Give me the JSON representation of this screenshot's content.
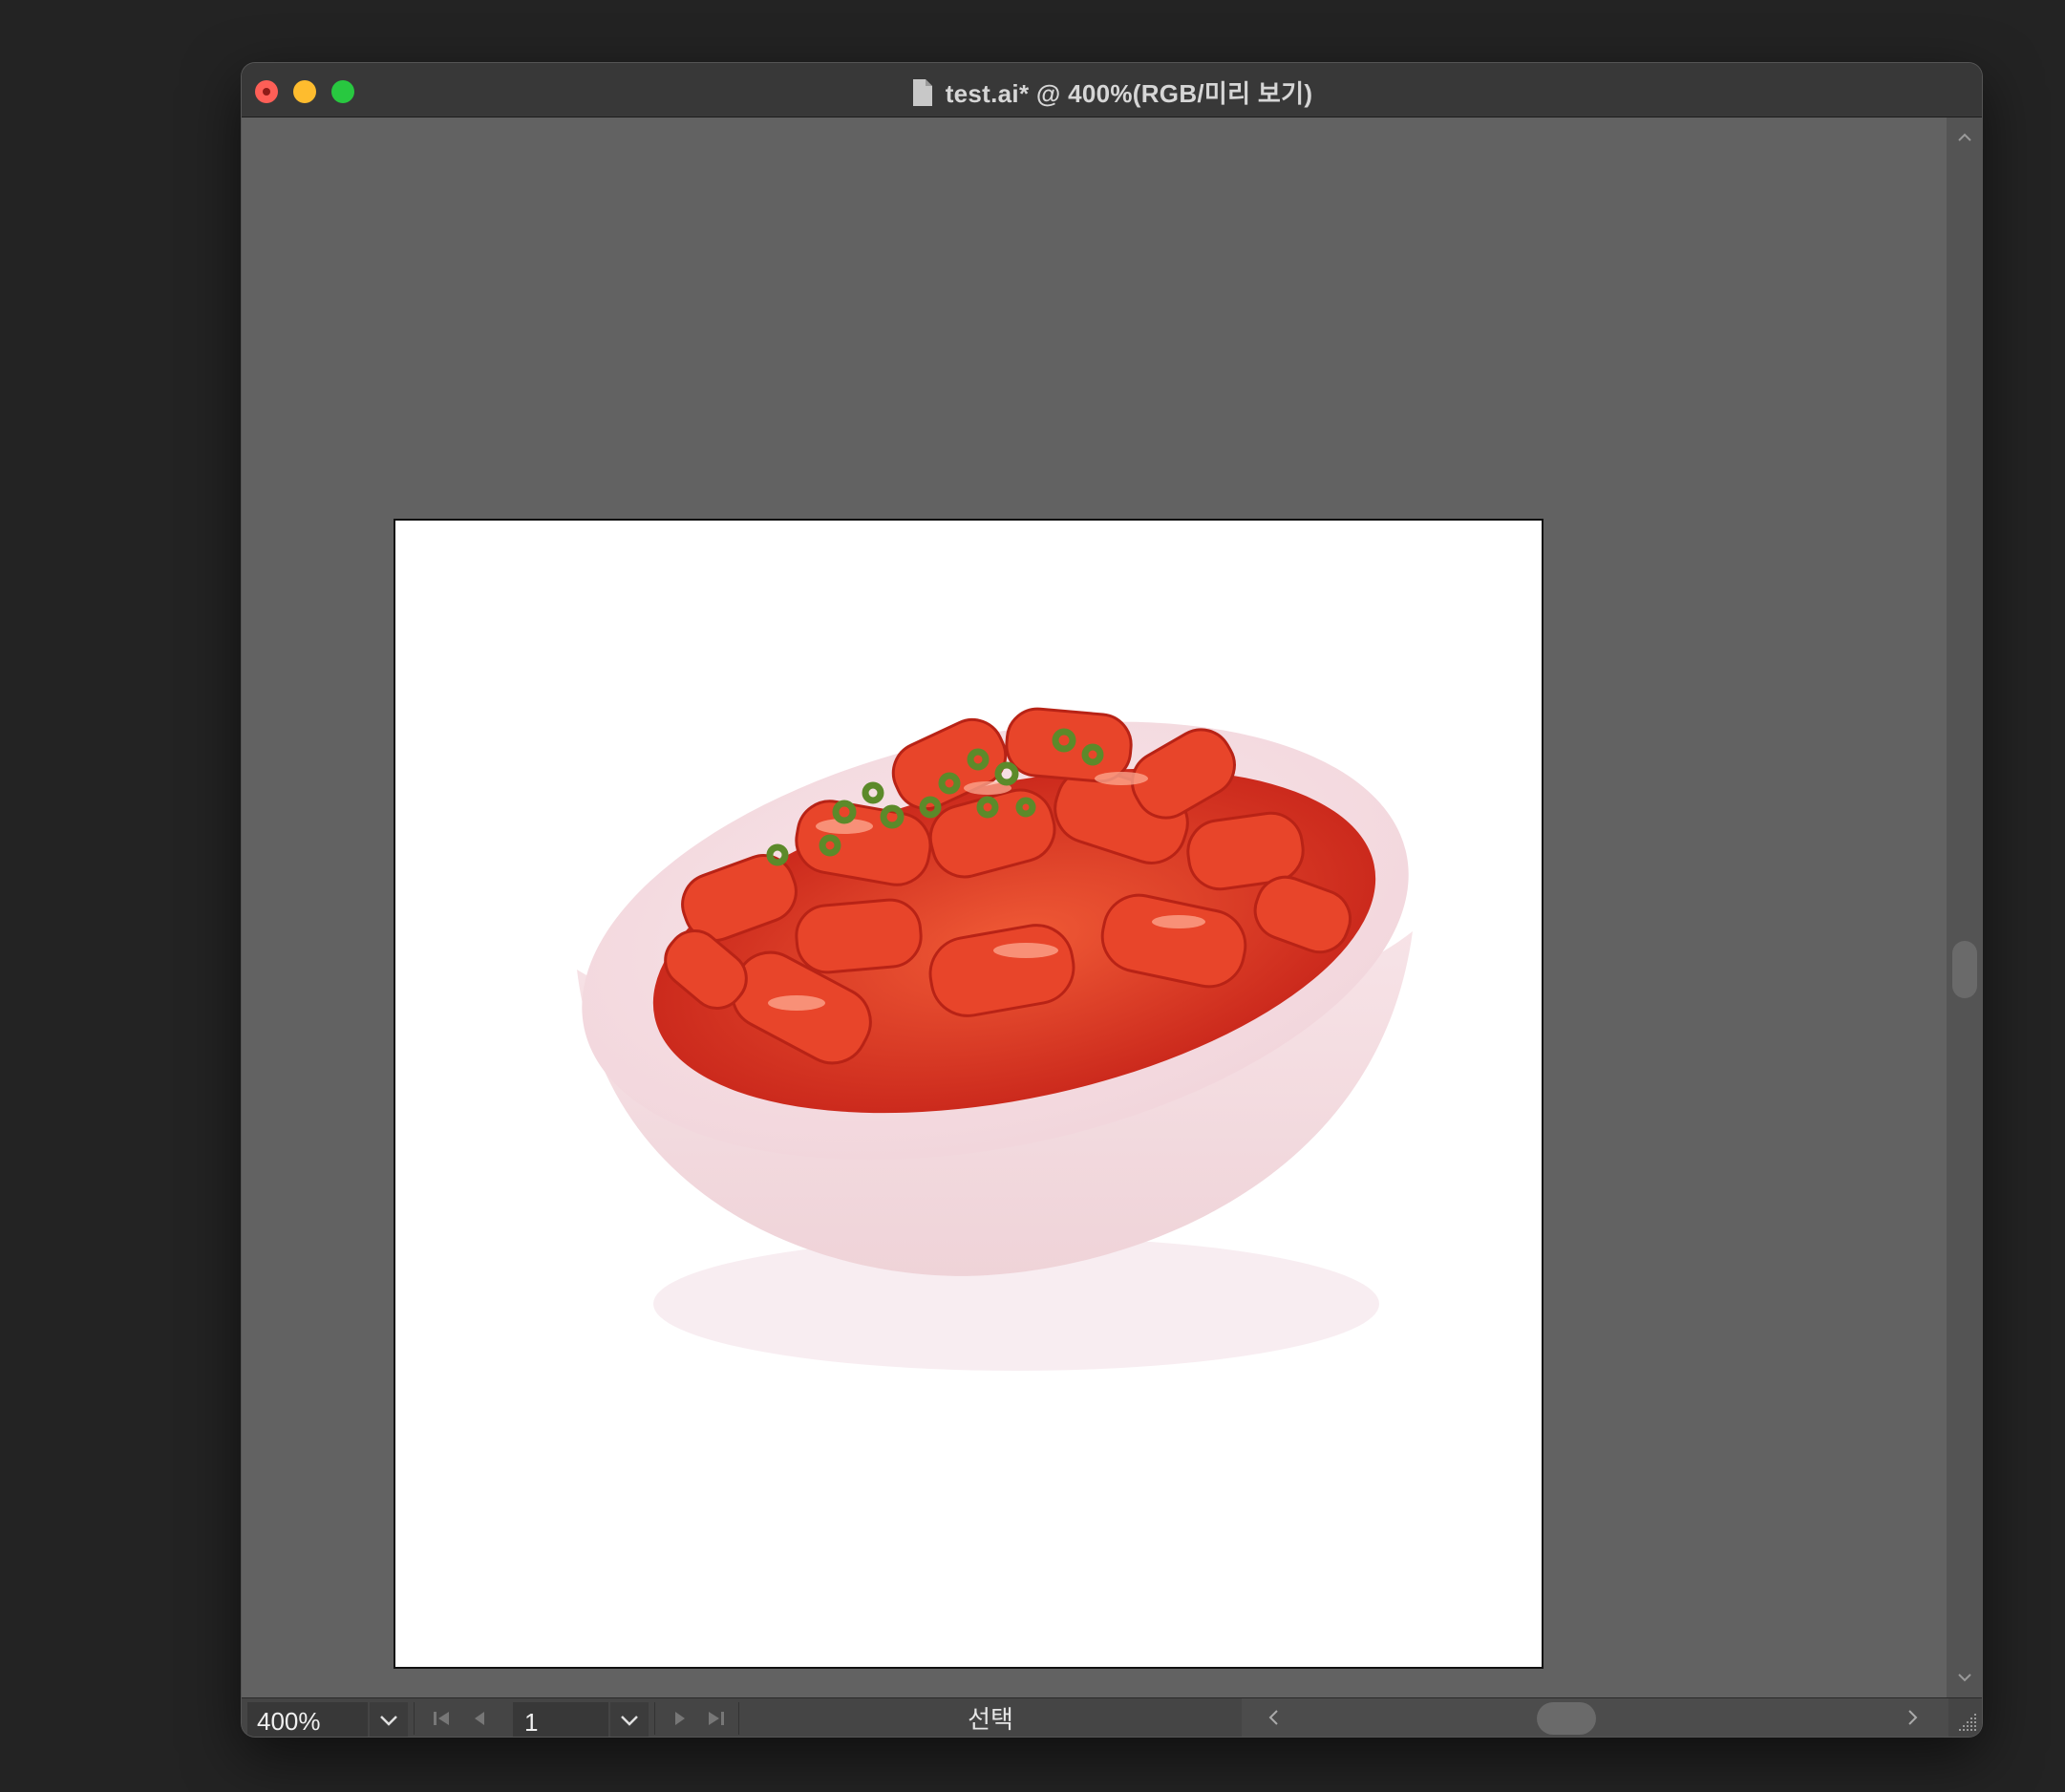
{
  "window": {
    "title": "test.ai* @ 400%(RGB/미리 보기)"
  },
  "document": {
    "image_alt": "tteokbokki in a white bowl"
  },
  "statusbar": {
    "zoom_value": "400%",
    "page_value": "1",
    "status_label": "선택"
  },
  "icons": {
    "close": "close-dot-icon",
    "minimize": "minimize-icon",
    "maximize": "maximize-icon",
    "doc": "document-icon",
    "scroll_up": "chevron-up-icon",
    "scroll_down": "chevron-down-icon",
    "first_page": "first-page-icon",
    "prev_page": "previous-page-icon",
    "next_page": "next-page-icon",
    "last_page": "last-page-icon",
    "play": "play-icon",
    "scroll_left": "chevron-left-icon",
    "scroll_right": "chevron-right-icon"
  },
  "colors": {
    "canvas_bg": "#626262",
    "artboard_bg": "#ffffff",
    "traffic_close": "#fe5f57",
    "traffic_min": "#febc2e",
    "traffic_max": "#28c840"
  }
}
